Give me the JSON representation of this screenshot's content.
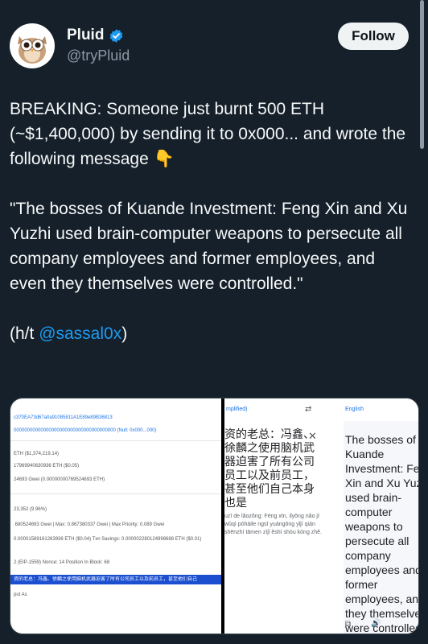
{
  "author": {
    "name": "Pluid",
    "handle": "@tryPluid",
    "verified_badge": "verified-badge-icon",
    "avatar": "owl-avatar-icon"
  },
  "follow_button": {
    "label": "Follow"
  },
  "tweet": {
    "paragraphs": [
      "BREAKING: Someone just burnt 500 ETH (~$1,400,000) by sending it to 0x000... and wrote the following message 👇",
      "\"The bosses of Kuande Investment: Feng Xin and Xu Yuzhi used brain-computer weapons to persecute all company employees and former employees, and even they themselves were controlled.\""
    ],
    "ht_prefix": "(h/t ",
    "ht_mention": "@sassal0x",
    "ht_suffix": ")"
  },
  "media": {
    "left_screenshot": {
      "lines": [
        "c370EA73d67a0a91085811A1E89e89B36813",
        "00000000000000000000000000000000000000 (Null: 0x000...000)",
        "ETH ($1,374,219.14)",
        "17969940630936 ETH ($0.05)",
        "24693 Gwei (0.00000000769524693 ETH)",
        "23,352 (9.96%)",
        ".680524693 Gwei  |  Max: 0.867380337 Gwei  |  Max Priority: 0.089 Gwei",
        "0.00001589161263936 ETH ($0.04)   Txn Savings: 0.000002280124998688 ETH ($0.01)",
        "2 (EIP-1559)    Nonce: 14    Position In Block: 68",
        "资的老总：冯鑫、徐麟之使用脑机武器迫害了所有公司员工以及前员工，甚至他们自己",
        "put As"
      ]
    },
    "right_screenshot": {
      "source_lang": "mplified)",
      "target_lang": "English",
      "zh_text": "资的老总：冯鑫、徐麟之使用脑机武器迫害了所有公司员工以及前员工，甚至他们自己本身也是",
      "zh_pinyin": "uzī de lǎozǒng: Féng xīn, ilyōng nǎo jī wǔqì pòhàile ngsī yuángōng yǐjí qián shēnzhì tāmen zìjǐ ěshì shòu kòng zhě.",
      "en_text": "The bosses of Kuande Investment: Feng Xin and Xu Yuzhi used brain-computer weapons to persecute all company employees and former employees, and they themselves were controlled"
    }
  },
  "colors": {
    "background": "#15202b",
    "text": "#f7f9f9",
    "muted": "#8b98a5",
    "link": "#1d9bf0",
    "verified": "#1d9bf0"
  }
}
